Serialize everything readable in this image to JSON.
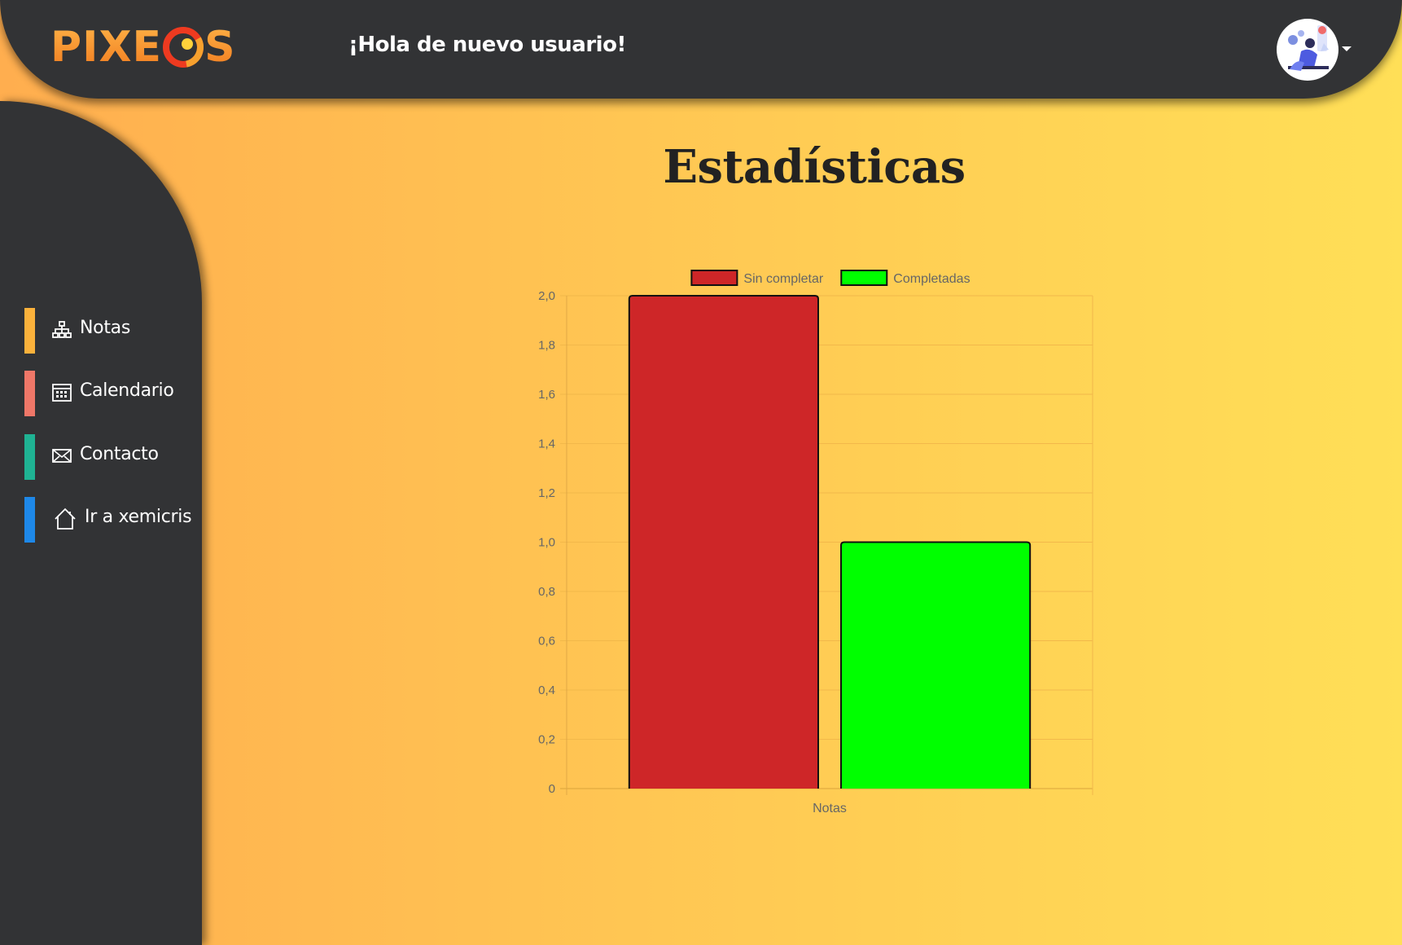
{
  "header": {
    "logo_text": "PIXEOS",
    "greeting": "¡Hola de nuevo usuario!",
    "colors": {
      "bar": "#323335",
      "logo_orange": "#f28a2a",
      "logo_red": "#ee3a20"
    }
  },
  "sidebar": {
    "items": [
      {
        "label": "Notas",
        "icon": "sitemap-icon",
        "accent": "#fbb23b"
      },
      {
        "label": "Calendario",
        "icon": "calendar-icon",
        "accent": "#ef7768"
      },
      {
        "label": "Contacto",
        "icon": "envelope-icon",
        "accent": "#1fb393"
      },
      {
        "label": "Ir a xemicris",
        "icon": "home-icon",
        "accent": "#1e88e8"
      }
    ]
  },
  "main": {
    "title": "Estadísticas"
  },
  "chart_data": {
    "type": "bar",
    "categories": [
      "Notas"
    ],
    "series": [
      {
        "name": "Sin completar",
        "values": [
          2
        ],
        "color": "#ce2628"
      },
      {
        "name": "Completadas",
        "values": [
          1
        ],
        "color": "#00ff00"
      }
    ],
    "ylim": [
      0,
      2
    ],
    "yticks": [
      "2,0",
      "1,8",
      "1,6",
      "1,4",
      "1,2",
      "1,0",
      "0,8",
      "0,6",
      "0,4",
      "0,2",
      "0"
    ],
    "legend": "top",
    "grid": true
  }
}
